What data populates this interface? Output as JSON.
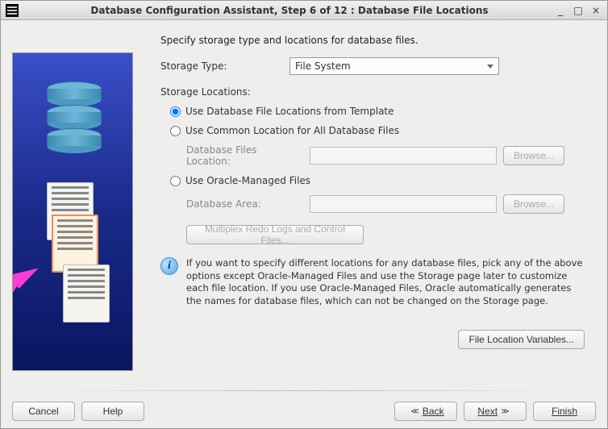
{
  "titlebar": {
    "title": "Database Configuration Assistant, Step 6 of 12 : Database File Locations"
  },
  "heading": "Specify storage type and locations for database files.",
  "storage_type": {
    "label": "Storage Type:",
    "selected": "File System"
  },
  "storage_locations": {
    "label": "Storage Locations:",
    "options": {
      "template": {
        "label": "Use Database File Locations from Template",
        "selected": true
      },
      "common": {
        "label": "Use Common Location for All Database Files",
        "selected": false,
        "sub_label": "Database Files Location:",
        "value": "",
        "browse": "Browse..."
      },
      "omf": {
        "label": "Use Oracle-Managed Files",
        "selected": false,
        "sub_label": "Database Area:",
        "value": "",
        "browse": "Browse...",
        "multiplex_btn": "Multiplex Redo Logs and Control Files..."
      }
    }
  },
  "info_text": "If you want to specify different locations for any database files, pick any of the above options except Oracle-Managed Files and use the Storage page later to customize each file location. If you use Oracle-Managed Files, Oracle automatically generates the names for database files, which can not be changed on the Storage page.",
  "file_loc_vars_btn": "File Location Variables...",
  "footer": {
    "cancel": "Cancel",
    "help": "Help",
    "back": "Back",
    "next": "Next",
    "finish": "Finish"
  }
}
